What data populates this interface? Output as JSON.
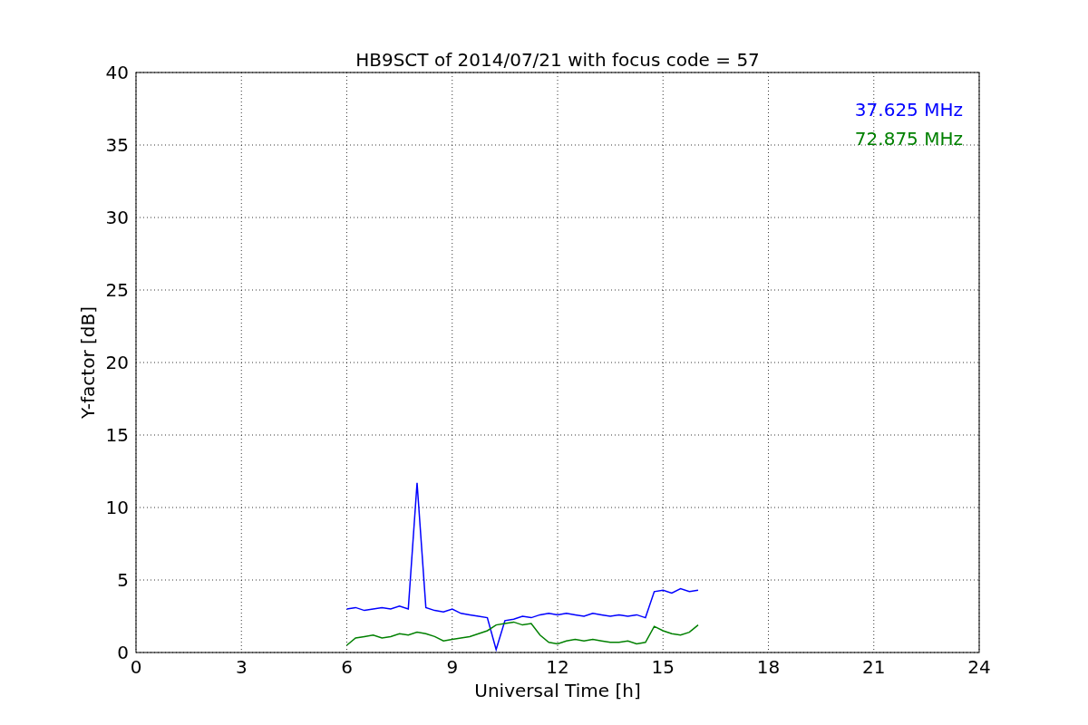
{
  "figure": {
    "chart_data": {
      "type": "line",
      "title": "HB9SCT of 2014/07/21 with focus code = 57",
      "xlabel": "Universal Time [h]",
      "ylabel": "Y-factor [dB]",
      "x": [
        6,
        6.25,
        6.5,
        6.75,
        7,
        7.25,
        7.5,
        7.75,
        8,
        8.25,
        8.5,
        8.75,
        9,
        9.25,
        9.5,
        9.75,
        10,
        10.25,
        10.5,
        10.75,
        11,
        11.25,
        11.5,
        11.75,
        12,
        12.25,
        12.5,
        12.75,
        13,
        13.25,
        13.5,
        13.75,
        14,
        14.25,
        14.5,
        14.75,
        15,
        15.25,
        15.5,
        15.75,
        16
      ],
      "series": [
        {
          "name": "37.625 MHz",
          "color": "#0000ff",
          "values": [
            3.0,
            3.1,
            2.9,
            3.0,
            3.1,
            3.0,
            3.2,
            3.0,
            11.7,
            3.1,
            2.9,
            2.8,
            3.0,
            2.7,
            2.6,
            2.5,
            2.4,
            0.2,
            2.2,
            2.3,
            2.5,
            2.4,
            2.6,
            2.7,
            2.6,
            2.7,
            2.6,
            2.5,
            2.7,
            2.6,
            2.5,
            2.6,
            2.5,
            2.6,
            2.4,
            4.2,
            4.3,
            4.1,
            4.4,
            4.2,
            4.3
          ]
        },
        {
          "name": "72.875 MHz",
          "color": "#008000",
          "values": [
            0.5,
            1.0,
            1.1,
            1.2,
            1.0,
            1.1,
            1.3,
            1.2,
            1.4,
            1.3,
            1.1,
            0.8,
            0.9,
            1.0,
            1.1,
            1.3,
            1.5,
            1.9,
            2.0,
            2.1,
            1.9,
            2.0,
            1.2,
            0.7,
            0.6,
            0.8,
            0.9,
            0.8,
            0.9,
            0.8,
            0.7,
            0.7,
            0.8,
            0.6,
            0.7,
            1.8,
            1.5,
            1.3,
            1.2,
            1.4,
            1.9
          ]
        }
      ],
      "grid": true,
      "xlim": [
        0,
        24
      ],
      "ylim": [
        0,
        40
      ],
      "xticks": [
        0,
        3,
        6,
        9,
        12,
        15,
        18,
        21,
        24
      ],
      "yticks": [
        0,
        5,
        10,
        15,
        20,
        25,
        30,
        35,
        40
      ]
    }
  }
}
